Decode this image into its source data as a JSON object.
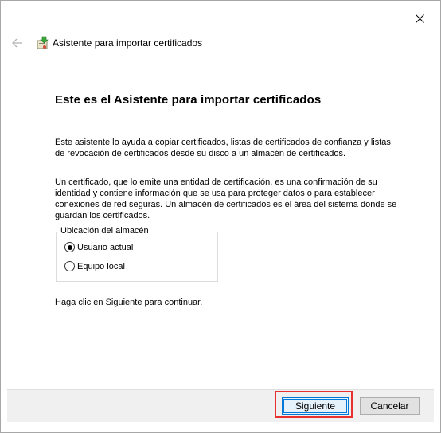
{
  "window": {
    "title": "Asistente para importar certificados"
  },
  "icons": {
    "close": "close-icon",
    "back": "back-arrow-icon",
    "wizard": "certificate-wizard-icon"
  },
  "content": {
    "heading": "Este es el Asistente para importar certificados",
    "paragraph1": "Este asistente lo ayuda a copiar certificados, listas de certificados de confianza y listas de revocación de certificados desde su disco a un almacén de certificados.",
    "paragraph2": "Un certificado, que lo emite una entidad de certificación, es una confirmación de su identidad y contiene información que se usa para proteger datos o para establecer conexiones de red seguras. Un almacén de certificados es el área del sistema donde se guardan los certificados.",
    "store_location": {
      "legend": "Ubicación del almacén",
      "options": [
        {
          "label": "Usuario actual",
          "selected": true
        },
        {
          "label": "Equipo local",
          "selected": false
        }
      ]
    },
    "instruction": "Haga clic en Siguiente para continuar."
  },
  "footer": {
    "next_label": "Siguiente",
    "cancel_label": "Cancelar"
  },
  "colors": {
    "accent": "#0078d7",
    "highlight": "#e8312f",
    "footer_bg": "#f0f0f0"
  }
}
